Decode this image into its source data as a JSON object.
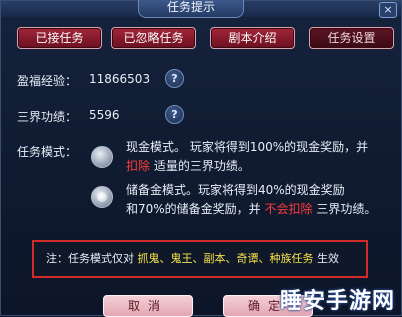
{
  "window": {
    "title": "任务提示",
    "close_glyph": "×"
  },
  "tabs": [
    {
      "label": "已接任务"
    },
    {
      "label": "已忽略任务"
    },
    {
      "label": "剧本介绍"
    },
    {
      "label": "任务设置"
    }
  ],
  "stats": {
    "exp_label": "盈福经验：",
    "exp_value": "11866503",
    "merit_label": "三界功绩：",
    "merit_value": "5596",
    "help_glyph": "?"
  },
  "mode": {
    "label": "任务模式：",
    "options": [
      {
        "line1": "现金模式。 玩家将得到100%的现金奖励，并",
        "line2_red": "扣除",
        "line2_rest": " 适量的三界功绩。",
        "selected": false
      },
      {
        "line1": "储备金模式。玩家将得到40%的现金奖励",
        "line2_pre": "和70%的储备金奖励，并 ",
        "line2_red": "不会扣除",
        "line2_post": " 三界功绩。",
        "selected": true
      }
    ]
  },
  "note": {
    "prefix": "注：任务模式仅对 ",
    "types": "抓鬼、鬼王、副本、奇谭、种族任务",
    "suffix": " 生效"
  },
  "buttons": {
    "cancel": "取消",
    "confirm": "确定"
  },
  "watermark": "睡安手游网",
  "colors": {
    "accent_red": "#ff3b3b",
    "highlight_yellow": "#f7e24a",
    "tab_red": "#a3263a"
  }
}
